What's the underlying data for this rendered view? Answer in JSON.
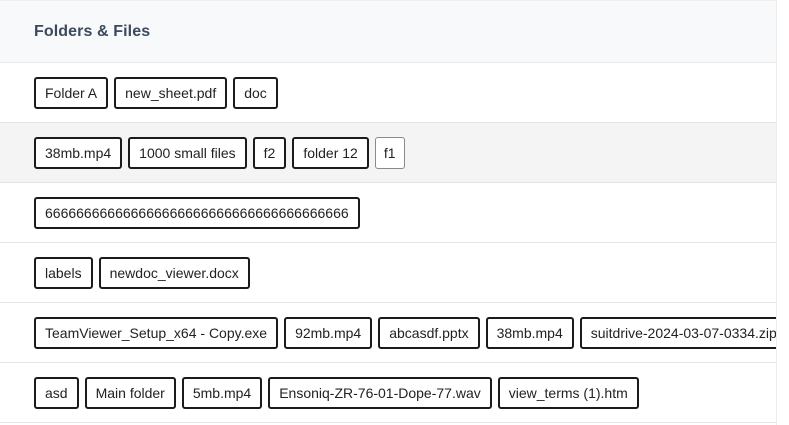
{
  "header": {
    "title": "Folders & Files"
  },
  "rows": [
    {
      "items": [
        "Folder A",
        "new_sheet.pdf",
        "doc"
      ]
    },
    {
      "items": [
        "38mb.mp4",
        "1000 small files",
        "f2",
        "folder 12",
        "f1"
      ]
    },
    {
      "items": [
        "666666666666666666666666666666666666666"
      ]
    },
    {
      "items": [
        "labels",
        "newdoc_viewer.docx"
      ]
    },
    {
      "items": [
        "TeamViewer_Setup_x64 - Copy.exe",
        "92mb.mp4",
        "abcasdf.pptx",
        "38mb.mp4",
        "suitdrive-2024-03-07-0334.zip"
      ]
    },
    {
      "items": [
        "asd",
        "Main folder",
        "5mb.mp4",
        "Ensoniq-ZR-76-01-Dope-77.wav",
        "view_terms (1).htm"
      ]
    }
  ]
}
